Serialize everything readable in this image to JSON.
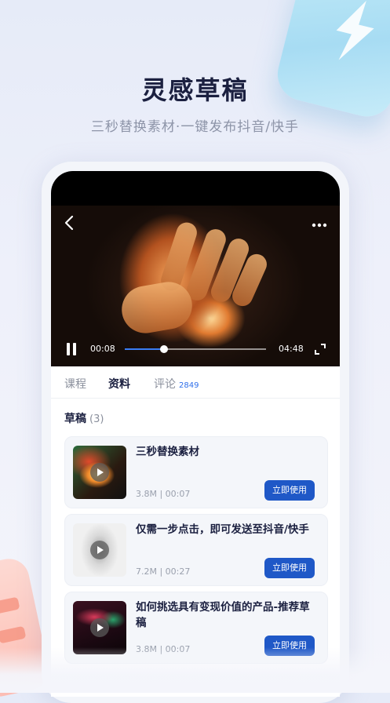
{
  "promo": {
    "headline": "灵感草稿",
    "subline": "三秒替换素材·一键发布抖音/快手"
  },
  "player": {
    "current_time": "00:08",
    "total_time": "04:48",
    "progress": 0.28,
    "back_icon": "chevron-left-icon",
    "more_icon": "more-dots-icon",
    "pause_icon": "pause-icon",
    "fullscreen_icon": "fullscreen-icon"
  },
  "tabs": [
    {
      "label": "课程",
      "active": false
    },
    {
      "label": "资料",
      "active": true
    },
    {
      "label": "评论",
      "count": "2849",
      "active": false
    }
  ],
  "drafts": {
    "title": "草稿",
    "count": "(3)",
    "items": [
      {
        "title": "三秒替换素材",
        "meta": "3.8M | 00:07",
        "button": "立即使用"
      },
      {
        "title": "仅需一步点击，即可发送至抖音/快手",
        "meta": "7.2M | 00:27",
        "button": "立即使用"
      },
      {
        "title": "如何挑选具有变现价值的产品-推荐草稿",
        "meta": "3.8M | 00:07",
        "button": "立即使用"
      }
    ]
  },
  "colors": {
    "accent": "#1f58c7",
    "progress": "#3a7df5",
    "deco_blue": "#a7dcf3",
    "deco_pink": "#ffb9ad"
  }
}
